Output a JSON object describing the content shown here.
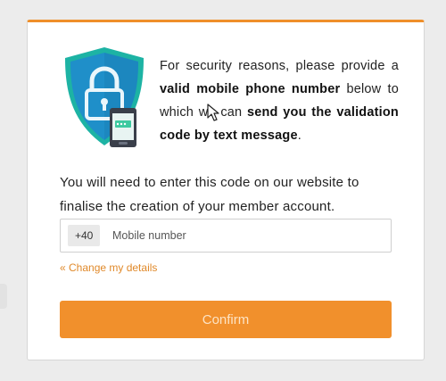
{
  "intro": {
    "part1": "For security reasons, please provide a ",
    "bold1": "valid mobile phone number",
    "part2": " below to which we can ",
    "bold2": "send you the validation code by text message",
    "part3": "."
  },
  "explain_text": "You will need to enter this code on our website to finalise the creation of your member account.",
  "phone": {
    "prefix": "+40",
    "placeholder": "Mobile number",
    "value": ""
  },
  "change_link": "« Change my details",
  "confirm_label": "Confirm",
  "colors": {
    "accent": "#f1902c",
    "link": "#e0892a",
    "shield_blue": "#1f8fc9",
    "shield_teal": "#1db3a4"
  },
  "icons": [
    "shield-lock-icon",
    "mobile-phone-icon",
    "mouse-cursor-icon"
  ]
}
